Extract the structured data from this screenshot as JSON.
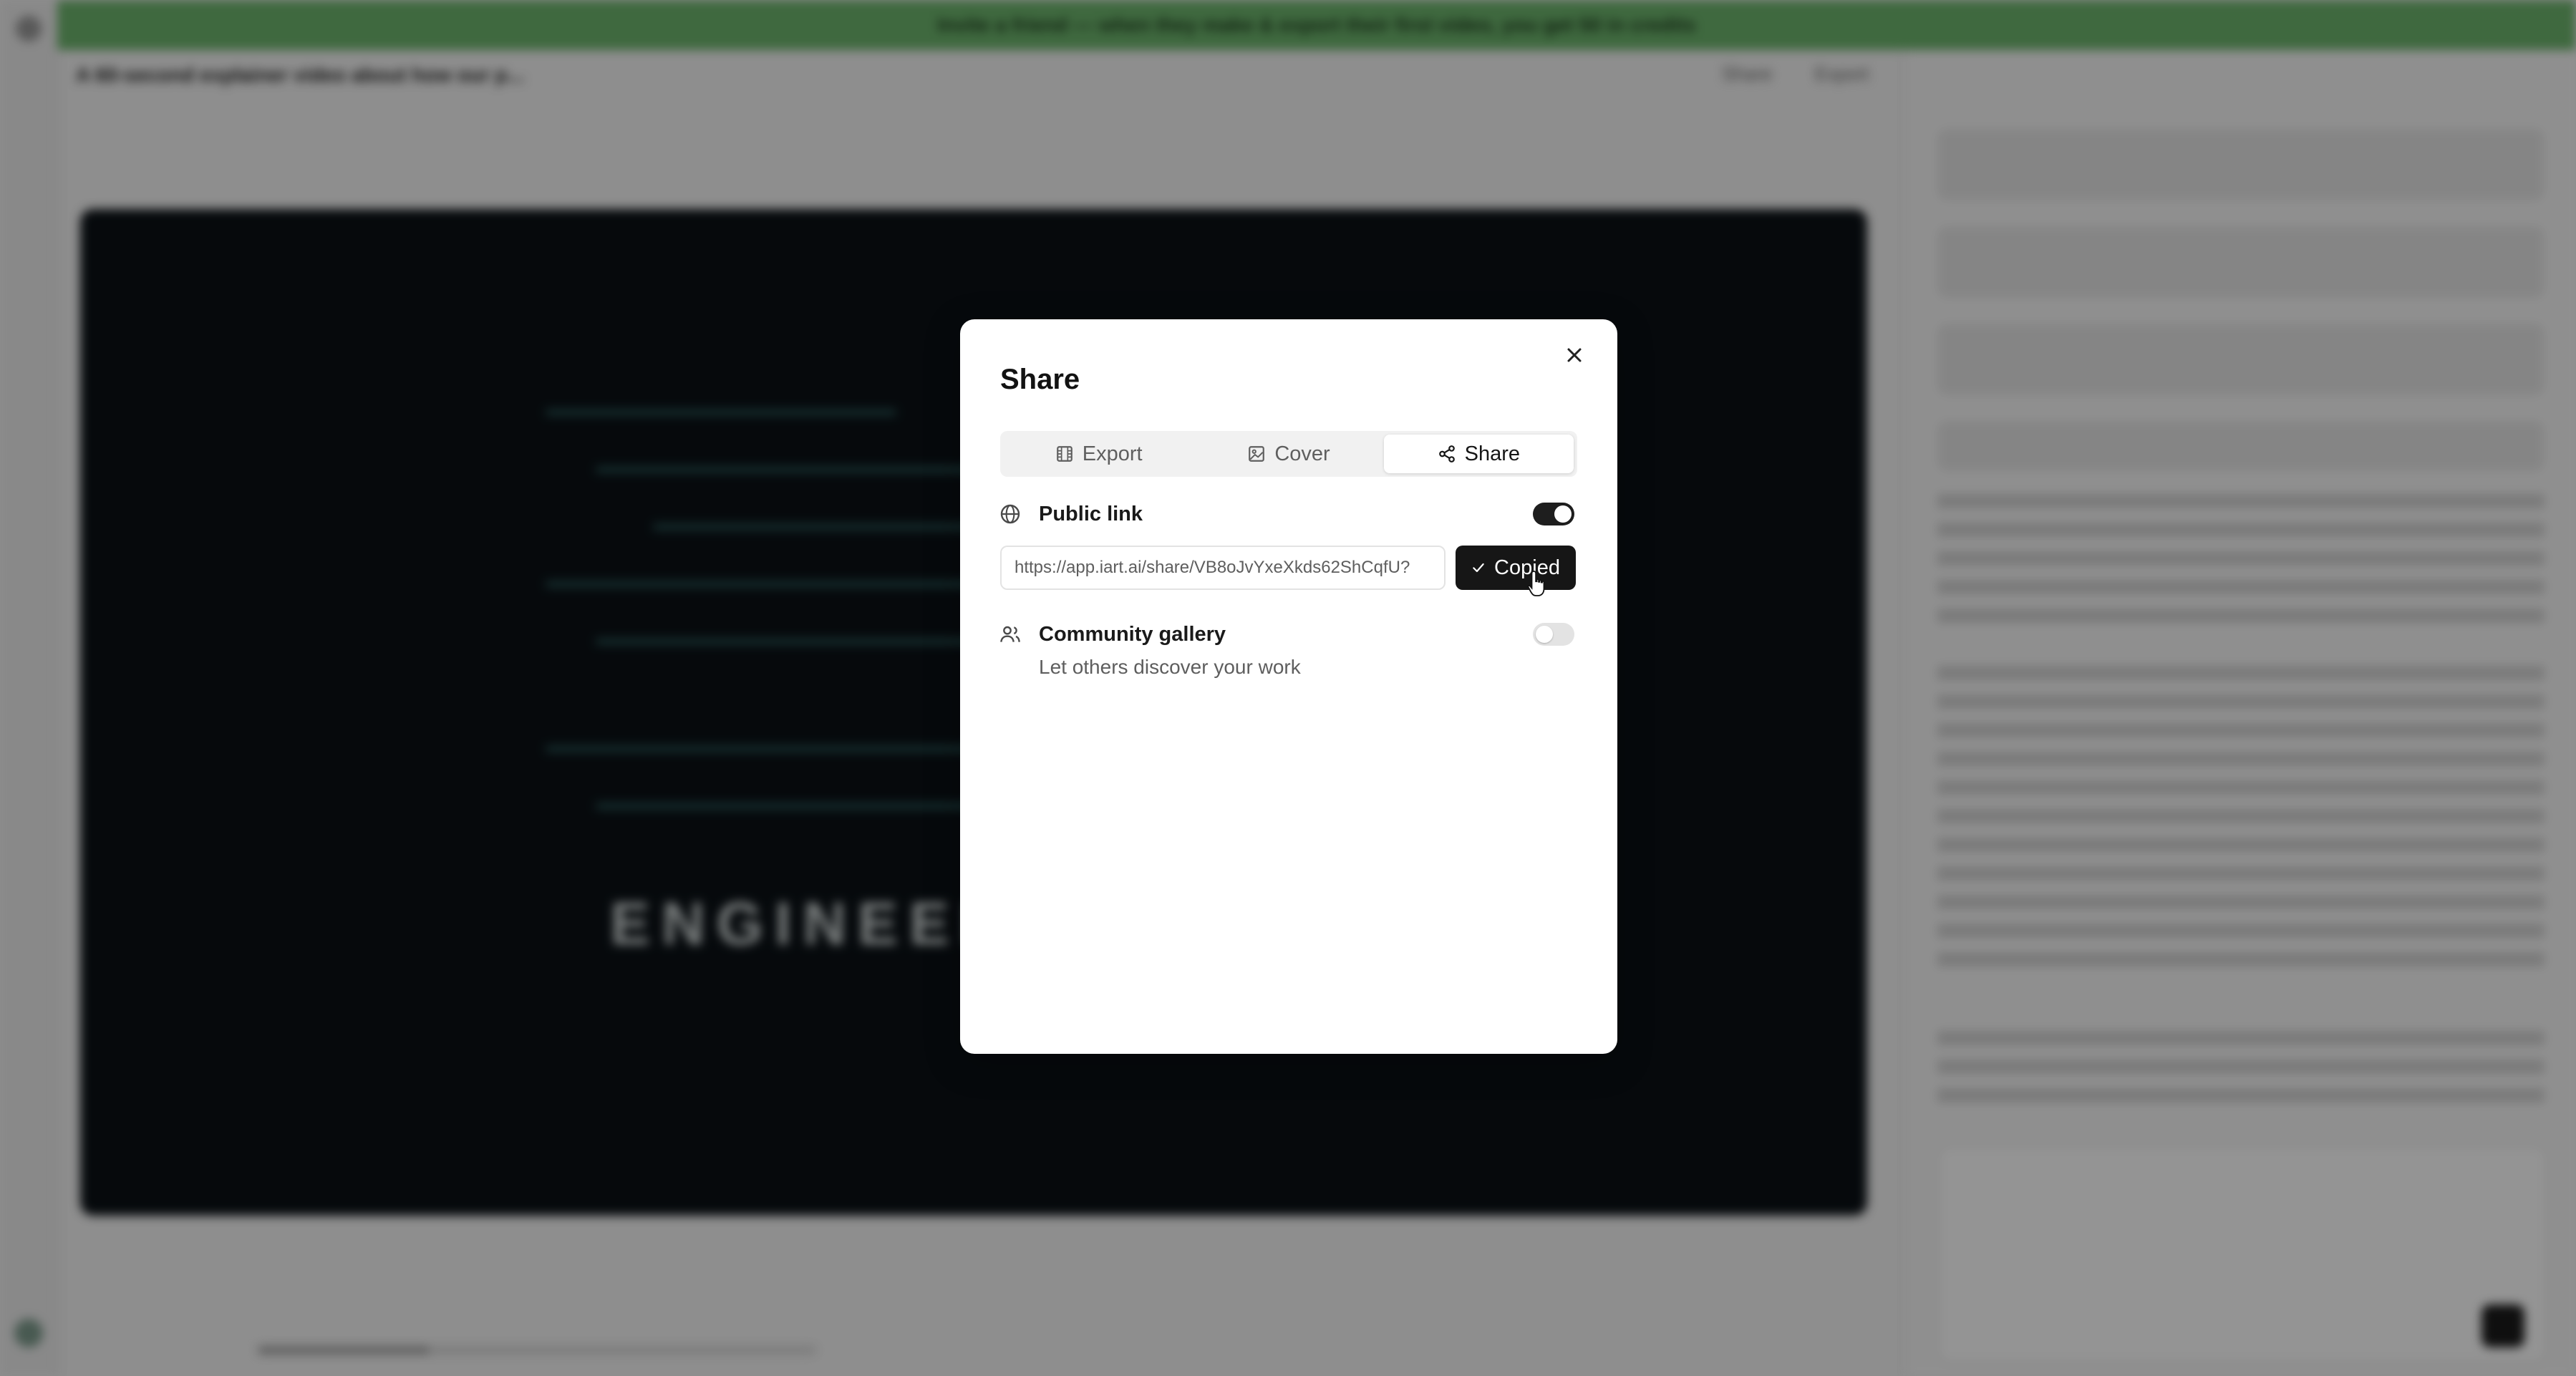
{
  "background": {
    "description_hidden": "",
    "banner": {
      "text": "Invite a friend — when they make & export their first video, you get 50 in credits"
    },
    "project_title": "A 60-second explainer video about how our p...",
    "header_actions": [
      "Share",
      "Export"
    ],
    "video_overlay_text": "ENGINEERI"
  },
  "modal": {
    "title": "Share",
    "tabs": [
      {
        "label": "Export",
        "icon": "film-icon",
        "active": false
      },
      {
        "label": "Cover",
        "icon": "image-icon",
        "active": false
      },
      {
        "label": "Share",
        "icon": "share-icon",
        "active": true
      }
    ],
    "public_link": {
      "label": "Public link",
      "enabled": true,
      "url": "https://app.iart.ai/share/VB8oJvYxeXkds62ShCqfU?",
      "copy_button_label": "Copied"
    },
    "community_gallery": {
      "label": "Community gallery",
      "description": "Let others discover your work",
      "enabled": false
    }
  },
  "colors": {
    "banner": "#6db56d",
    "primary_dark": "#161616",
    "modal_bg": "#ffffff"
  }
}
